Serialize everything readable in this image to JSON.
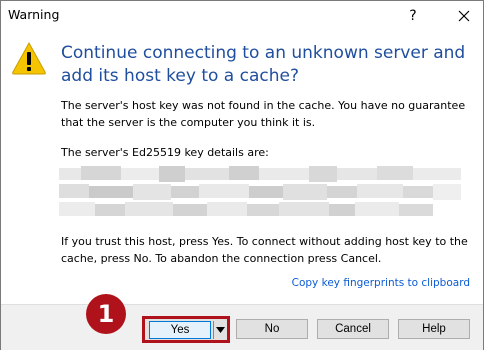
{
  "window": {
    "title": "Warning",
    "help_glyph": "?",
    "close_icon": "close-icon",
    "warning_icon": "warning-triangle-icon"
  },
  "dialog": {
    "heading": "Continue connecting to an unknown server and add its host key to a cache?",
    "message1": "The server's host key was not found in the cache. You have no guarantee that the server is the computer you think it is.",
    "message2": "The server's Ed25519 key details are:",
    "message3": "If you trust this host, press Yes. To connect without adding host key to the cache, press No. To abandon the connection press Cancel.",
    "copy_link": "Copy key fingerprints to clipboard"
  },
  "buttons": {
    "yes": "Yes",
    "no": "No",
    "cancel": "Cancel",
    "help": "Help"
  },
  "annotation": {
    "step_number": "1",
    "color": "#b0121b"
  },
  "colors": {
    "heading": "#1f4e9e",
    "link": "#0b5bd3",
    "footer": "#f0f0f0"
  }
}
